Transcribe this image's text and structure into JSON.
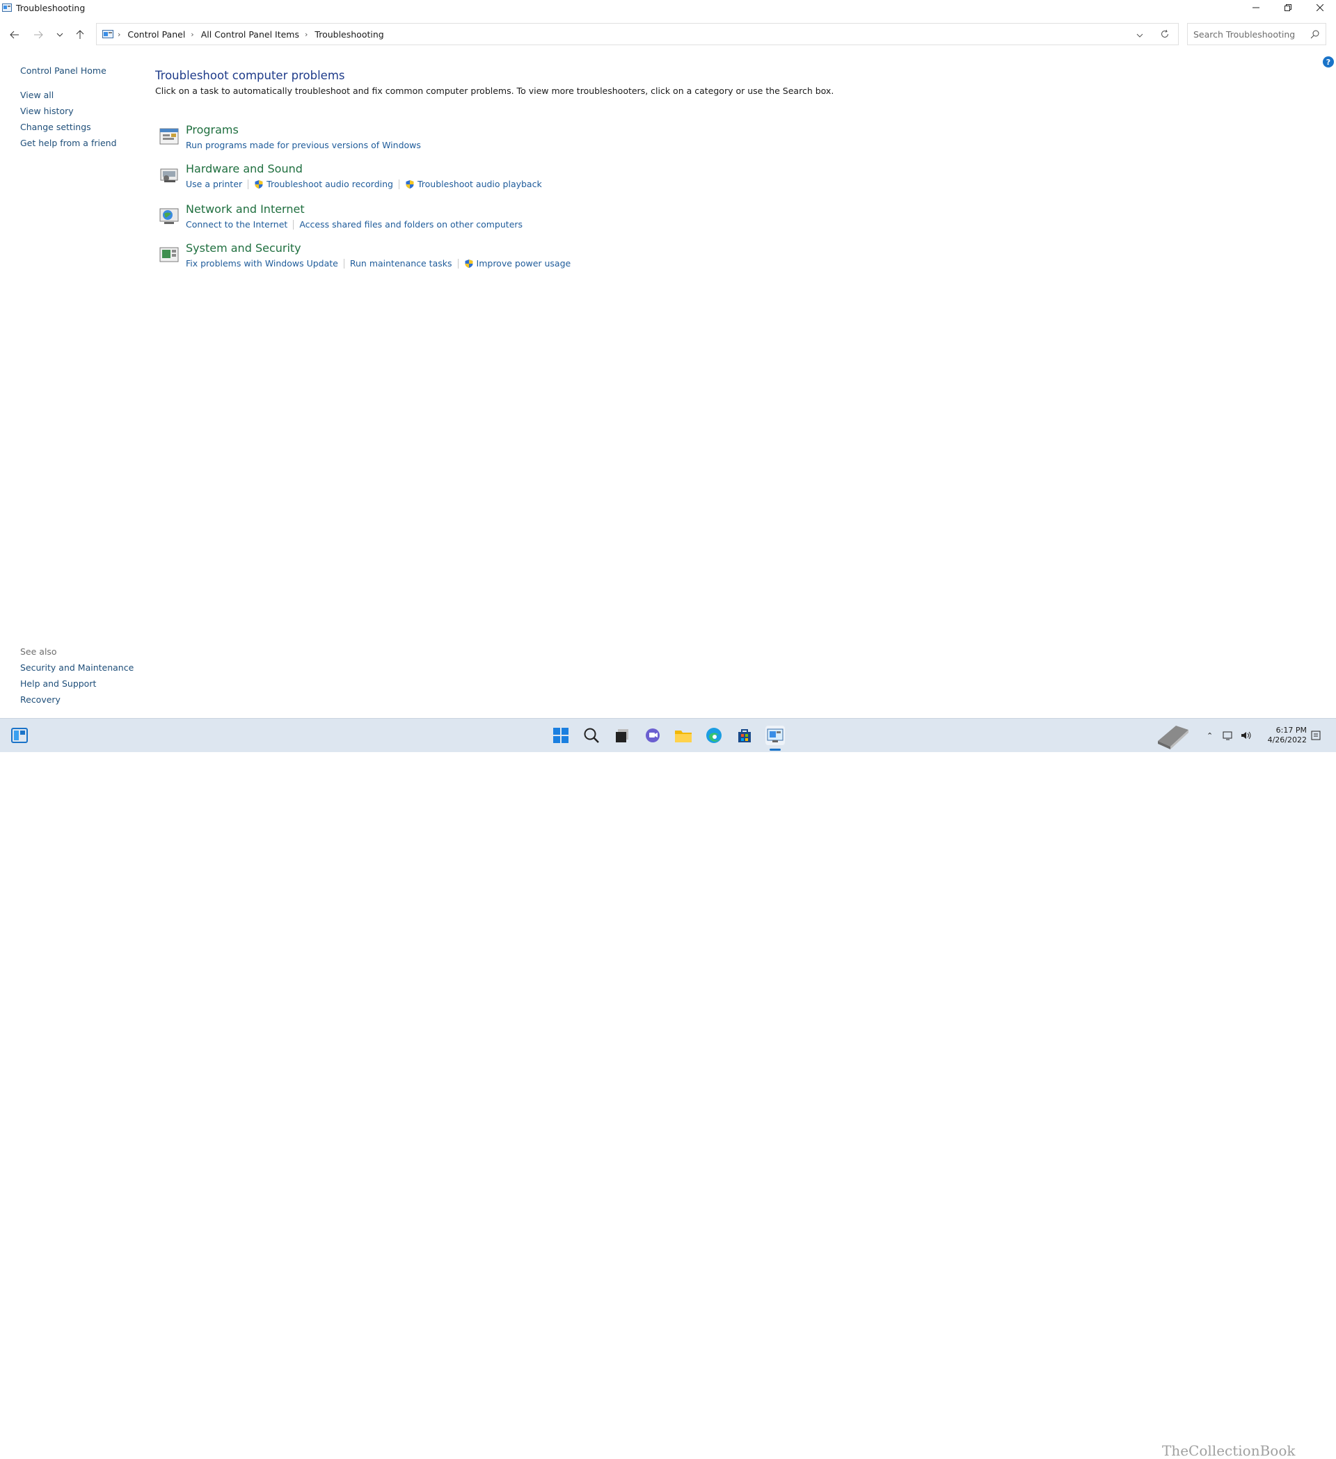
{
  "window": {
    "title": "Troubleshooting"
  },
  "address": {
    "crumbs": [
      "Control Panel",
      "All Control Panel Items",
      "Troubleshooting"
    ]
  },
  "search": {
    "placeholder": "Search Troubleshooting"
  },
  "sidebar": {
    "home": "Control Panel Home",
    "items": [
      "View all",
      "View history",
      "Change settings",
      "Get help from a friend"
    ]
  },
  "see_also": {
    "header": "See also",
    "items": [
      "Security and Maintenance",
      "Help and Support",
      "Recovery"
    ]
  },
  "main": {
    "title": "Troubleshoot computer problems",
    "description": "Click on a task to automatically troubleshoot and fix common computer problems. To view more troubleshooters, click on a category or use the Search box.",
    "categories": [
      {
        "name": "Programs",
        "icon": "programs-icon",
        "links": [
          {
            "label": "Run programs made for previous versions of Windows",
            "shield": false
          }
        ]
      },
      {
        "name": "Hardware and Sound",
        "icon": "hardware-sound-icon",
        "links": [
          {
            "label": "Use a printer",
            "shield": false
          },
          {
            "label": "Troubleshoot audio recording",
            "shield": true
          },
          {
            "label": "Troubleshoot audio playback",
            "shield": true
          }
        ]
      },
      {
        "name": "Network and Internet",
        "icon": "network-icon",
        "links": [
          {
            "label": "Connect to the Internet",
            "shield": false
          },
          {
            "label": "Access shared files and folders on other computers",
            "shield": false
          }
        ]
      },
      {
        "name": "System and Security",
        "icon": "system-security-icon",
        "links": [
          {
            "label": "Fix problems with Windows Update",
            "shield": false
          },
          {
            "label": "Run maintenance tasks",
            "shield": false
          },
          {
            "label": "Improve power usage",
            "shield": true
          }
        ]
      }
    ]
  },
  "taskbar": {
    "time": "6:17 PM",
    "date": "4/26/2022",
    "watermark": "TheCollectionBook"
  },
  "colors": {
    "link": "#1e5b9a",
    "category": "#1f6f3f",
    "title": "#1e3b8a",
    "taskbar": "#dde6f0"
  }
}
